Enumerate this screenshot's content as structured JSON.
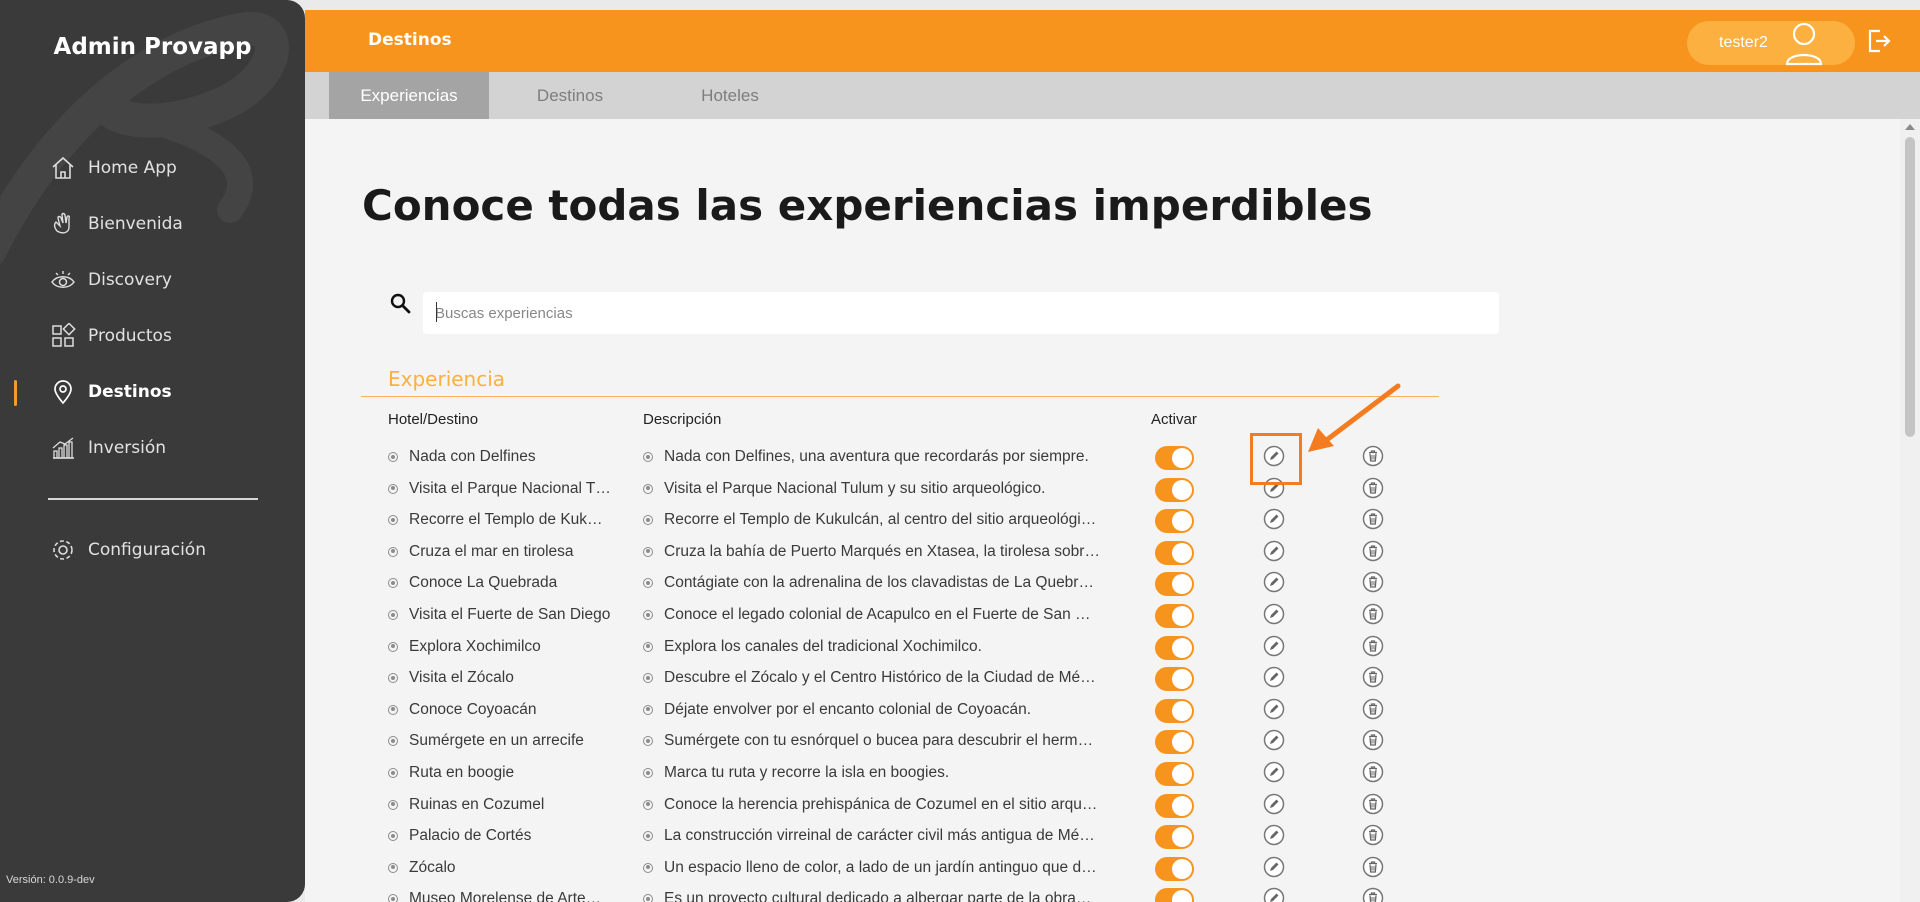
{
  "app": {
    "brand": "Admin Provapp",
    "version": "Versión: 0.0.9-dev"
  },
  "sidebar": {
    "items": [
      {
        "label": "Home App",
        "icon": "home-icon"
      },
      {
        "label": "Bienvenida",
        "icon": "wave-hand-icon"
      },
      {
        "label": "Discovery",
        "icon": "eye-icon"
      },
      {
        "label": "Productos",
        "icon": "grid-icon"
      },
      {
        "label": "Destinos",
        "icon": "location-pin-icon",
        "active": true
      },
      {
        "label": "Inversión",
        "icon": "bar-chart-icon"
      }
    ],
    "settings": {
      "label": "Configuración",
      "icon": "gear-icon"
    }
  },
  "header": {
    "title": "Destinos",
    "user": "tester2",
    "user_icon": "user-icon",
    "logout_icon": "logout-icon"
  },
  "tabs": [
    {
      "label": "Experiencias",
      "active": true
    },
    {
      "label": "Destinos"
    },
    {
      "label": "Hoteles"
    }
  ],
  "main": {
    "title": "Conoce todas las experiencias imperdibles",
    "search": {
      "placeholder": "Buscas experiencias",
      "value": ""
    },
    "section": "Experiencia",
    "columns": {
      "hotel": "Hotel/Destino",
      "description": "Descripción",
      "activate": "Activar"
    },
    "rows": [
      {
        "name": "Nada con Delfines",
        "description": "Nada con Delfines, una aventura que recordarás por siempre.",
        "active": true
      },
      {
        "name": "Visita el Parque Nacional T…",
        "description": "Visita el Parque Nacional Tulum y su sitio arqueológico.",
        "active": true
      },
      {
        "name": "Recorre el Templo de Kuk…",
        "description": "Recorre el Templo de Kukulcán, al centro del sitio arqueológi…",
        "active": true
      },
      {
        "name": "Cruza el mar en tirolesa",
        "description": "Cruza la bahía de Puerto Marqués en Xtasea, la tirolesa sobr…",
        "active": true
      },
      {
        "name": "Conoce La Quebrada",
        "description": "Contágiate con la adrenalina de los clavadistas de La Quebr…",
        "active": true
      },
      {
        "name": "Visita el Fuerte de San Diego",
        "description": "Conoce el legado colonial de Acapulco en el Fuerte de San …",
        "active": true
      },
      {
        "name": "Explora Xochimilco",
        "description": "Explora los canales del tradicional Xochimilco.",
        "active": true
      },
      {
        "name": "Visita el Zócalo",
        "description": "Descubre el Zócalo y el Centro Histórico de la Ciudad de Mé…",
        "active": true
      },
      {
        "name": "Conoce Coyoacán",
        "description": "Déjate envolver por el encanto colonial de Coyoacán.",
        "active": true
      },
      {
        "name": "Sumérgete en un arrecife",
        "description": "Sumérgete con tu esnórquel o bucea para descubrir el herm…",
        "active": true
      },
      {
        "name": "Ruta en boogie",
        "description": "Marca tu ruta y recorre la isla en boogies.",
        "active": true
      },
      {
        "name": "Ruinas en Cozumel",
        "description": "Conoce la herencia prehispánica de Cozumel en el sitio arqu…",
        "active": true
      },
      {
        "name": "Palacio de Cortés",
        "description": "La construcción virreinal de carácter civil más antigua de Mé…",
        "active": true
      },
      {
        "name": "Zócalo",
        "description": "Un espacio lleno de color, a lado de un jardín antinguo que d…",
        "active": true
      },
      {
        "name": "Museo Morelense de Arte…",
        "description": "Es un proyecto cultural dedicado a albergar parte de la obra…",
        "active": true
      }
    ]
  },
  "colors": {
    "accent": "#f7941d",
    "sidebar": "#3a3a3a",
    "accent_light": "#fbb040"
  }
}
